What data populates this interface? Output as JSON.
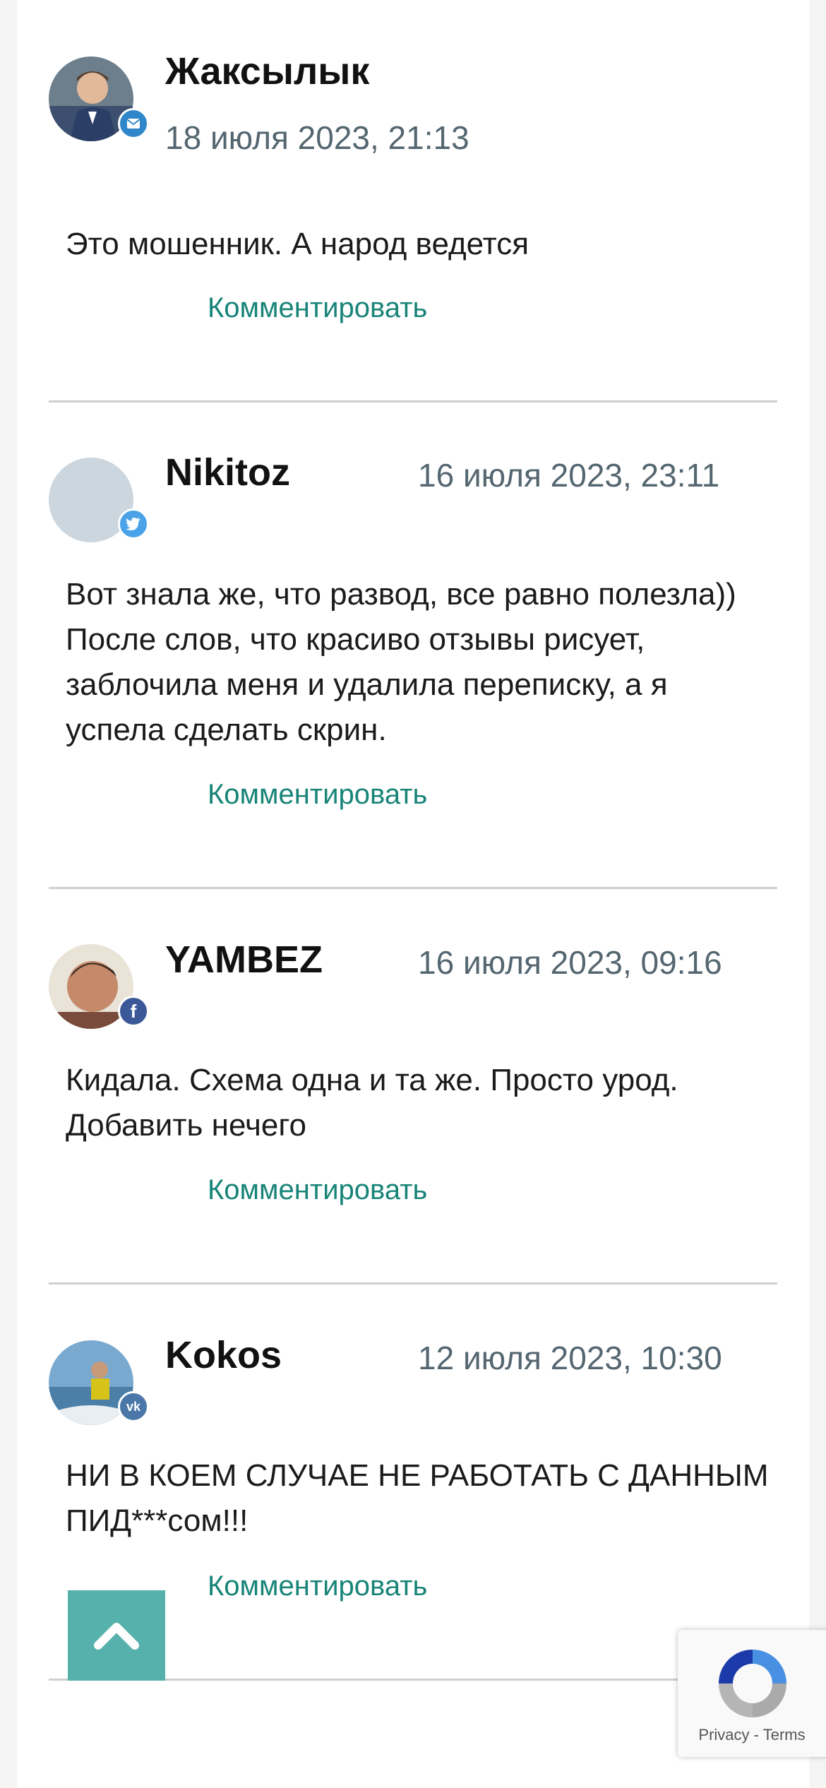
{
  "comments": [
    {
      "author": "Жаксылык",
      "date": "18 июля 2023, 21:13",
      "text": "Это мошенник. А народ ведется",
      "reply_label": "Комментировать",
      "social": "email-icon",
      "social_color": "#2f86c9"
    },
    {
      "author": "Nikitoz",
      "date": "16 июля 2023, 23:11",
      "text": "Вот знала же, что развод, все равно полезла)) После слов, что красиво отзывы рисует, заблочила меня и удалила переписку, а я успела сделать скрин.",
      "reply_label": "Комментировать",
      "social": "twitter-icon",
      "social_color": "#4aa3e8"
    },
    {
      "author": "YAMBEZ",
      "date": "16 июля 2023, 09:16",
      "text": "Кидала. Схема одна и та же. Просто урод. Добавить нечего",
      "reply_label": "Комментировать",
      "social": "facebook-icon",
      "social_color": "#3b5998"
    },
    {
      "author": "Kokos",
      "date": "12 июля 2023, 10:30",
      "text": "НИ В КОЕМ СЛУЧАЕ НЕ РАБОТАТЬ С ДАННЫМ ПИД***сом!!!",
      "reply_label": "Комментировать",
      "social": "vk-icon",
      "social_color": "#4a76a8"
    }
  ],
  "recaptcha": {
    "privacy": "Privacy",
    "separator": "-",
    "terms": "Terms"
  },
  "colors": {
    "accent": "#188478",
    "scroll_button": "#56b1ac",
    "date": "#546670"
  }
}
